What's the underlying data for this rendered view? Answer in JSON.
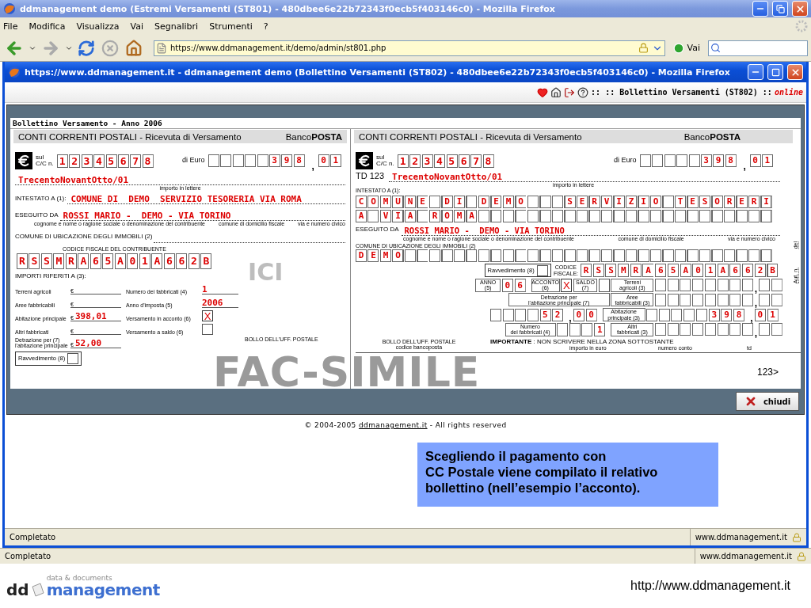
{
  "browser": {
    "title": "ddmanagement demo (Estremi Versamenti (ST801) - 480dbee6e22b72343f0ecb5f403146c0) - Mozilla Firefox",
    "menu": [
      "File",
      "Modifica",
      "Visualizza",
      "Vai",
      "Segnalibri",
      "Strumenti",
      "?"
    ],
    "address": "https://www.ddmanagement.it/demo/admin/st801.php",
    "go": "Vai",
    "status": "Completato",
    "status_host": "www.ddmanagement.it"
  },
  "popup": {
    "title": "https://www.ddmanagement.it - ddmanagement demo (Bollettino Versamenti (ST802) - 480dbee6e22b72343f0ecb5f403146c0) - Mozilla Firefox",
    "breadcrumb": ":: :: Bollettino Versamenti (ST802) ::",
    "connection": "online",
    "form_title": "Bollettino Versamento - Anno 2006",
    "close_button": "chiudi",
    "copyright": "© 2004-2005",
    "copyright_link": "ddmanagement.it",
    "copyright_rest": "- All rights reserved",
    "status": "Completato",
    "status_host": "www.ddmanagement.it"
  },
  "receipt": {
    "header": "CONTI CORRENTI POSTALI - Ricevuta di Versamento",
    "brand": "Banco**POSTA**",
    "account_label": [
      "sul",
      "C/C n."
    ],
    "account": "12345678",
    "euro_label": "di Euro",
    "amount_int": "398",
    "decimal_separator": ",",
    "amount_dec": "01",
    "amount_words": "TrecentoNovantOtto/01",
    "amount_words_hint": "importo in lettere",
    "payee_label": "INTESTATO A (1):",
    "payee": "COMUNE DI  DEMO  SERVIZIO TESORERIA VIA ROMA",
    "payer_label": "ESEGUITO DA",
    "payer": "ROSSI MARIO -  DEMO - VIA TORINO",
    "payer_hints": [
      "cognome e nome o ragione sociale o denominazione del contribuente",
      "comune di domicilio fiscale",
      "via e numero civico"
    ],
    "property_label": "COMUNE DI UBICAZIONE DEGLI IMMOBILI (2)",
    "tax_code_label": "CODICE FISCALE DEL CONTRIBUENTE",
    "tax_code": "RSSMRA65A01A662B",
    "amounts_label": "IMPORTI RIFERITI A (3):",
    "currency": "€",
    "amounts": [
      {
        "lines": [
          "Terreni agricoli"
        ]
      },
      {
        "lines": [
          "Aree fabbricabili"
        ]
      },
      {
        "lines": [
          "Abitazione principale"
        ],
        "value": "398,01"
      },
      {
        "lines": [
          "Altri fabbricati"
        ]
      },
      {
        "lines": [
          "Detrazione per (7)",
          "l'abitazione principale"
        ],
        "value": "52,00"
      }
    ],
    "details": [
      {
        "kind": "text",
        "label": "Numero dei fabbricati (4)",
        "value": "1"
      },
      {
        "kind": "text",
        "label": "Anno d'imposta (5)",
        "value": "2006"
      },
      {
        "kind": "check",
        "label": "Versamento in acconto (6)",
        "checked": true
      },
      {
        "kind": "check",
        "label": "Versamento a saldo (6)",
        "checked": false
      }
    ],
    "tick": "X",
    "late_label": "Ravvedimento (8)",
    "late_checked": false,
    "stamp": "BOLLO DELL'UFF. POSTALE",
    "watermark": "ICI"
  },
  "slip": {
    "header": "CONTI CORRENTI POSTALI - Ricevuta di Versamento",
    "brand": "Banco**POSTA**",
    "account_label": [
      "sul",
      "C/C n."
    ],
    "account": "12345678",
    "euro_label": "di Euro",
    "amount_int": "398",
    "decimal_separator": ",",
    "amount_dec": "01",
    "doc_type": "TD 123",
    "amount_words": "TrecentoNovantOtto/01",
    "amount_words_hint": "importo in lettere",
    "payee_label": "INTESTATO A (1):",
    "payee_rows": [
      "COMUNE DI DEMO   SERVIZIO TESORERI",
      "A VIA ROMA"
    ],
    "payer_label": "ESEGUITO DA",
    "payer": "ROSSI MARIO -  DEMO - VIA TORINO",
    "payer_hints": [
      "cognome e nome o ragione sociale o denominazione del contribuente",
      "comune di domicilio fiscale",
      "via e numero civico"
    ],
    "property_label": "COMUNE DI UBICAZIONE DEGLI IMMOBILI (2)",
    "property": "DEMO",
    "late_label": "Ravvedimento (8)",
    "late_checked": false,
    "tax_code_label": [
      "CODICE",
      "FISCALE:"
    ],
    "tax_code": "RSSMRA65A01A662B",
    "year_label": [
      "ANNO",
      "(5)"
    ],
    "year": "06",
    "advance_label": [
      "ACCONTO",
      "(6)"
    ],
    "advance_checked": true,
    "balance_label": [
      "SALDO",
      "(7)"
    ],
    "balance_checked": false,
    "tick": "X",
    "amounts": [
      {
        "label": [
          "Terreni",
          "agricoli (3)"
        ]
      },
      {
        "label": [
          "Aree",
          "fabbricabili (3)"
        ]
      },
      {
        "label": [
          "Abitazione",
          "principale (3)"
        ],
        "int": "398",
        "dec": "01"
      },
      {
        "label": [
          "Altri",
          "fabbricati (3)"
        ]
      }
    ],
    "deduction_label": [
      "Detrazione per",
      "l'abitazione principale (7)"
    ],
    "deduction_int": "52",
    "deduction_dec": "00",
    "buildings_label": [
      "Numero",
      "dei fabbricati (4)"
    ],
    "buildings": "1",
    "date_label": "del",
    "auth_label": "Aut. n.",
    "stamp": "BOLLO DELL'UFF. POSTALE",
    "stamp_sub": "codice bancoposta",
    "notice_bold": "IMPORTANTE",
    "notice": ": NON SCRIVERE NELLA ZONA SOTTOSTANTE",
    "bottom_labels": [
      "importo in euro",
      "numero conto",
      "td"
    ],
    "code_line": "123>"
  },
  "watermark": "FAC-SIMILE",
  "caption": [
    "Scegliendo il pagamento con",
    "CC Postale viene compilato il relativo",
    "bollettino (nell’esempio l’acconto)."
  ],
  "footer": {
    "logo_dd": "dd",
    "logo_tagline": "data & documents",
    "logo_word": "management",
    "url": "http://www.ddmanagement.it"
  }
}
